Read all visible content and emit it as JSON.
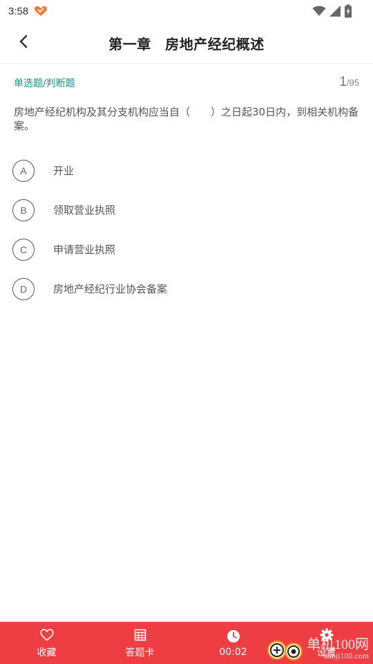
{
  "status_bar": {
    "time": "3:58"
  },
  "header": {
    "title": "第一章　房地产经纪概述"
  },
  "question": {
    "type_label": "单选题/判断题",
    "current": "1",
    "total": "/95",
    "text": "房地产经纪机构及其分支机构应当自（　　）之日起30日内，到相关机构备案。",
    "options": [
      {
        "letter": "A",
        "text": "开业"
      },
      {
        "letter": "B",
        "text": "领取营业执照"
      },
      {
        "letter": "C",
        "text": "申请营业执照"
      },
      {
        "letter": "D",
        "text": "房地产经纪行业协会备案"
      }
    ]
  },
  "bottom_bar": {
    "favorite_label": "收藏",
    "answer_card_label": "答题卡",
    "timer": "00:02",
    "settings_label": "设置"
  },
  "watermark": {
    "text_big": "单机100网",
    "text_small": "danji100.com"
  },
  "colors": {
    "accent": "#ee3e44",
    "type_label": "#1a8f8a"
  }
}
